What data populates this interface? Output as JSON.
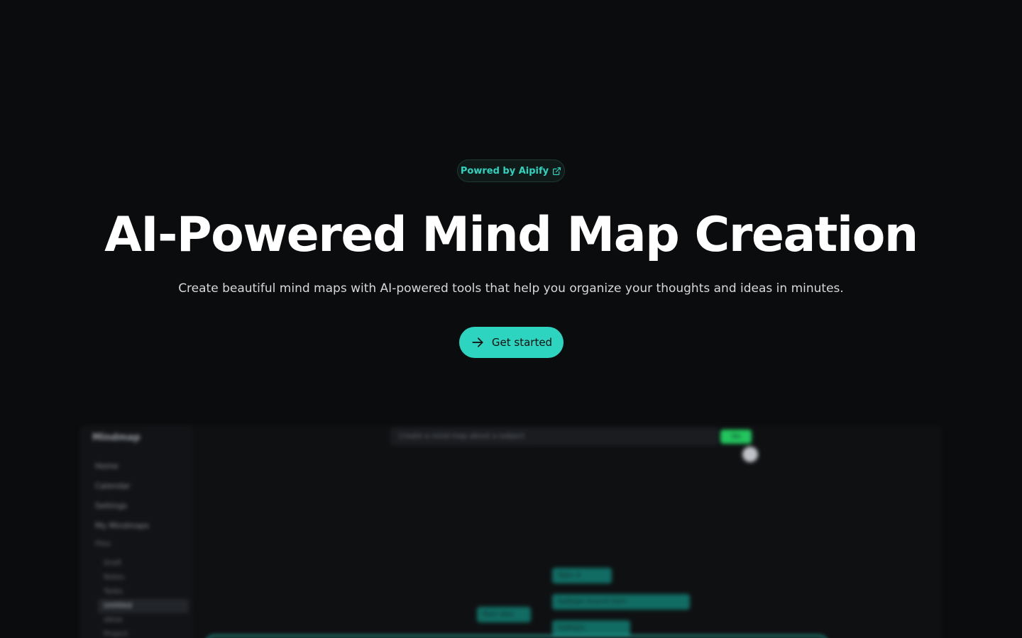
{
  "badge": {
    "label": "Powred by Aipify",
    "icon": "external-link-icon"
  },
  "hero": {
    "title": "AI-Powered Mind Map Creation",
    "subtitle": "Create beautiful mind maps with AI-powered tools that help you organize your thoughts and ideas in minutes."
  },
  "cta": {
    "label": "Get started",
    "icon": "arrow-right-icon"
  },
  "colors": {
    "background": "#0b0c0e",
    "accent": "#2dd4bf",
    "badge_text": "#2dd4bf"
  },
  "preview": {
    "logo": "Mindmap",
    "nav": [
      "Home",
      "Calendar",
      "Settings",
      "My Mindmaps"
    ],
    "section": "Files",
    "files": [
      "Draft",
      "Notes",
      "Tasks",
      "Untitled",
      "Ideas",
      "Project"
    ],
    "prompt_placeholder": "Create a mind map about a subject",
    "generate_label": "Go",
    "nodes": [
      "Topic A",
      "Main Idea",
      "Subtopic branch item",
      "Subtopic"
    ]
  }
}
